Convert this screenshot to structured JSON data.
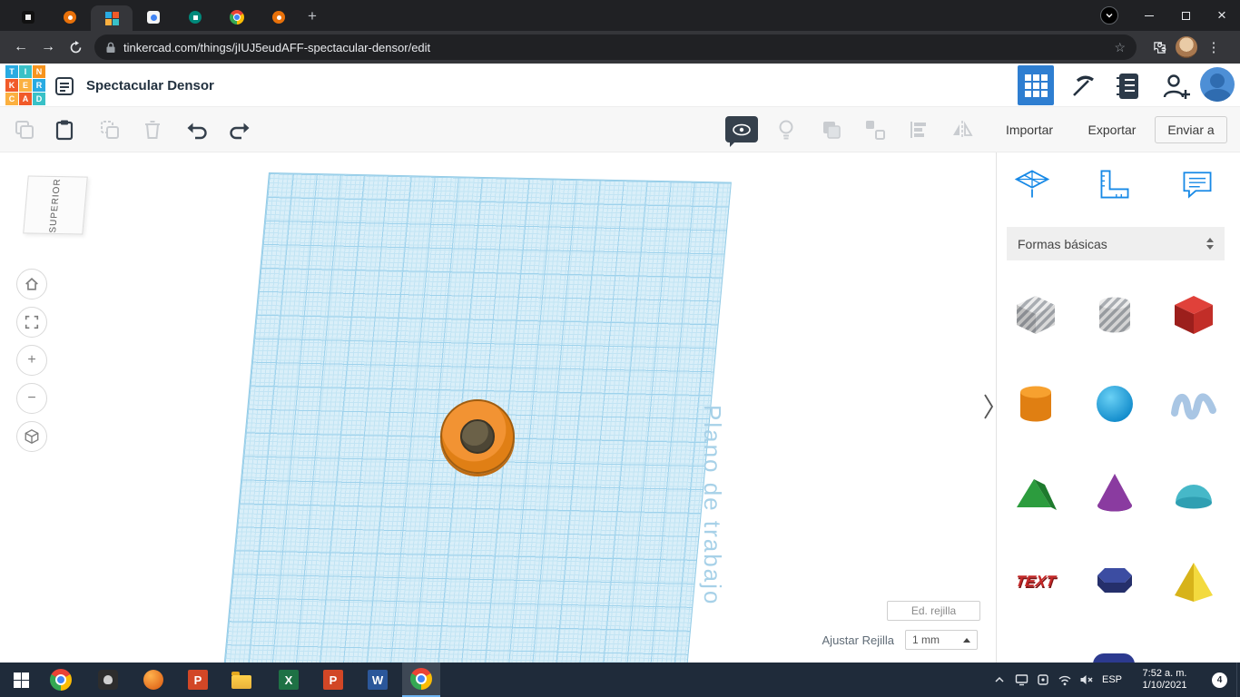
{
  "browser": {
    "url": "tinkercad.com/things/jIUJ5eudAFF-spectacular-densor/edit",
    "tabs": [
      "favicon-dark-site",
      "favicon-orange-people",
      "favicon-tinkercad",
      "favicon-photos",
      "favicon-teal-chat",
      "favicon-google",
      "favicon-orange-people-2"
    ]
  },
  "icons": {
    "back": "←",
    "forward": "→",
    "star": "☆",
    "menu": "⋮",
    "close": "×",
    "new_tab": "+",
    "zoom_in": "+",
    "zoom_out": "−"
  },
  "header": {
    "logo": [
      "T",
      "I",
      "N",
      "K",
      "E",
      "R",
      "C",
      "A",
      "D"
    ],
    "title": "Spectacular Densor"
  },
  "toolbar": {
    "import": "Importar",
    "export": "Exportar",
    "send": "Enviar a"
  },
  "viewcube": {
    "top": "SUPERIOR"
  },
  "canvas": {
    "workplane": "Plano de trabajo"
  },
  "panel": {
    "category": "Formas básicas",
    "text_shape": "TEXT",
    "shapes": [
      "box-hole",
      "cylinder-hole",
      "box",
      "cylinder",
      "sphere",
      "scribble",
      "roof",
      "cone",
      "dome",
      "text",
      "polygon",
      "pyramid",
      "partial-shape"
    ]
  },
  "grid": {
    "edit": "Ed. rejilla",
    "snap": "Ajustar Rejilla",
    "value": "1 mm"
  },
  "taskbar": {
    "lang": "ESP",
    "time": "7:52 a. m.",
    "date": "1/10/2021",
    "badge": "4",
    "apps": {
      "excel": "X",
      "ppt": "P",
      "word": "W"
    }
  }
}
